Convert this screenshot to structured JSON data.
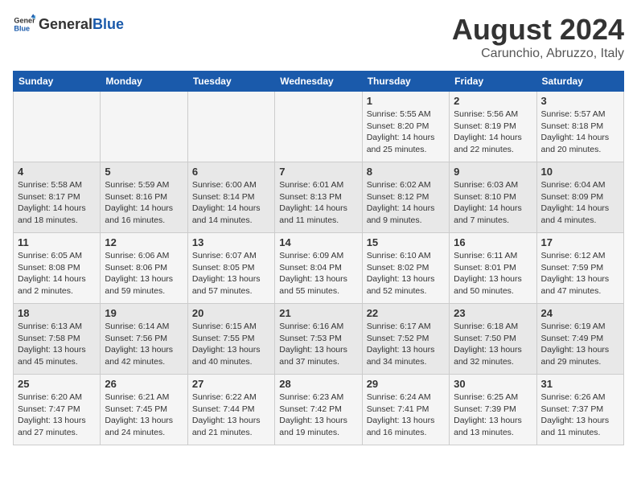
{
  "header": {
    "logo_general": "General",
    "logo_blue": "Blue",
    "title": "August 2024",
    "subtitle": "Carunchio, Abruzzo, Italy"
  },
  "calendar": {
    "days_of_week": [
      "Sunday",
      "Monday",
      "Tuesday",
      "Wednesday",
      "Thursday",
      "Friday",
      "Saturday"
    ],
    "weeks": [
      [
        {
          "day": "",
          "info": ""
        },
        {
          "day": "",
          "info": ""
        },
        {
          "day": "",
          "info": ""
        },
        {
          "day": "",
          "info": ""
        },
        {
          "day": "1",
          "info": "Sunrise: 5:55 AM\nSunset: 8:20 PM\nDaylight: 14 hours\nand 25 minutes."
        },
        {
          "day": "2",
          "info": "Sunrise: 5:56 AM\nSunset: 8:19 PM\nDaylight: 14 hours\nand 22 minutes."
        },
        {
          "day": "3",
          "info": "Sunrise: 5:57 AM\nSunset: 8:18 PM\nDaylight: 14 hours\nand 20 minutes."
        }
      ],
      [
        {
          "day": "4",
          "info": "Sunrise: 5:58 AM\nSunset: 8:17 PM\nDaylight: 14 hours\nand 18 minutes."
        },
        {
          "day": "5",
          "info": "Sunrise: 5:59 AM\nSunset: 8:16 PM\nDaylight: 14 hours\nand 16 minutes."
        },
        {
          "day": "6",
          "info": "Sunrise: 6:00 AM\nSunset: 8:14 PM\nDaylight: 14 hours\nand 14 minutes."
        },
        {
          "day": "7",
          "info": "Sunrise: 6:01 AM\nSunset: 8:13 PM\nDaylight: 14 hours\nand 11 minutes."
        },
        {
          "day": "8",
          "info": "Sunrise: 6:02 AM\nSunset: 8:12 PM\nDaylight: 14 hours\nand 9 minutes."
        },
        {
          "day": "9",
          "info": "Sunrise: 6:03 AM\nSunset: 8:10 PM\nDaylight: 14 hours\nand 7 minutes."
        },
        {
          "day": "10",
          "info": "Sunrise: 6:04 AM\nSunset: 8:09 PM\nDaylight: 14 hours\nand 4 minutes."
        }
      ],
      [
        {
          "day": "11",
          "info": "Sunrise: 6:05 AM\nSunset: 8:08 PM\nDaylight: 14 hours\nand 2 minutes."
        },
        {
          "day": "12",
          "info": "Sunrise: 6:06 AM\nSunset: 8:06 PM\nDaylight: 13 hours\nand 59 minutes."
        },
        {
          "day": "13",
          "info": "Sunrise: 6:07 AM\nSunset: 8:05 PM\nDaylight: 13 hours\nand 57 minutes."
        },
        {
          "day": "14",
          "info": "Sunrise: 6:09 AM\nSunset: 8:04 PM\nDaylight: 13 hours\nand 55 minutes."
        },
        {
          "day": "15",
          "info": "Sunrise: 6:10 AM\nSunset: 8:02 PM\nDaylight: 13 hours\nand 52 minutes."
        },
        {
          "day": "16",
          "info": "Sunrise: 6:11 AM\nSunset: 8:01 PM\nDaylight: 13 hours\nand 50 minutes."
        },
        {
          "day": "17",
          "info": "Sunrise: 6:12 AM\nSunset: 7:59 PM\nDaylight: 13 hours\nand 47 minutes."
        }
      ],
      [
        {
          "day": "18",
          "info": "Sunrise: 6:13 AM\nSunset: 7:58 PM\nDaylight: 13 hours\nand 45 minutes."
        },
        {
          "day": "19",
          "info": "Sunrise: 6:14 AM\nSunset: 7:56 PM\nDaylight: 13 hours\nand 42 minutes."
        },
        {
          "day": "20",
          "info": "Sunrise: 6:15 AM\nSunset: 7:55 PM\nDaylight: 13 hours\nand 40 minutes."
        },
        {
          "day": "21",
          "info": "Sunrise: 6:16 AM\nSunset: 7:53 PM\nDaylight: 13 hours\nand 37 minutes."
        },
        {
          "day": "22",
          "info": "Sunrise: 6:17 AM\nSunset: 7:52 PM\nDaylight: 13 hours\nand 34 minutes."
        },
        {
          "day": "23",
          "info": "Sunrise: 6:18 AM\nSunset: 7:50 PM\nDaylight: 13 hours\nand 32 minutes."
        },
        {
          "day": "24",
          "info": "Sunrise: 6:19 AM\nSunset: 7:49 PM\nDaylight: 13 hours\nand 29 minutes."
        }
      ],
      [
        {
          "day": "25",
          "info": "Sunrise: 6:20 AM\nSunset: 7:47 PM\nDaylight: 13 hours\nand 27 minutes."
        },
        {
          "day": "26",
          "info": "Sunrise: 6:21 AM\nSunset: 7:45 PM\nDaylight: 13 hours\nand 24 minutes."
        },
        {
          "day": "27",
          "info": "Sunrise: 6:22 AM\nSunset: 7:44 PM\nDaylight: 13 hours\nand 21 minutes."
        },
        {
          "day": "28",
          "info": "Sunrise: 6:23 AM\nSunset: 7:42 PM\nDaylight: 13 hours\nand 19 minutes."
        },
        {
          "day": "29",
          "info": "Sunrise: 6:24 AM\nSunset: 7:41 PM\nDaylight: 13 hours\nand 16 minutes."
        },
        {
          "day": "30",
          "info": "Sunrise: 6:25 AM\nSunset: 7:39 PM\nDaylight: 13 hours\nand 13 minutes."
        },
        {
          "day": "31",
          "info": "Sunrise: 6:26 AM\nSunset: 7:37 PM\nDaylight: 13 hours\nand 11 minutes."
        }
      ]
    ]
  }
}
